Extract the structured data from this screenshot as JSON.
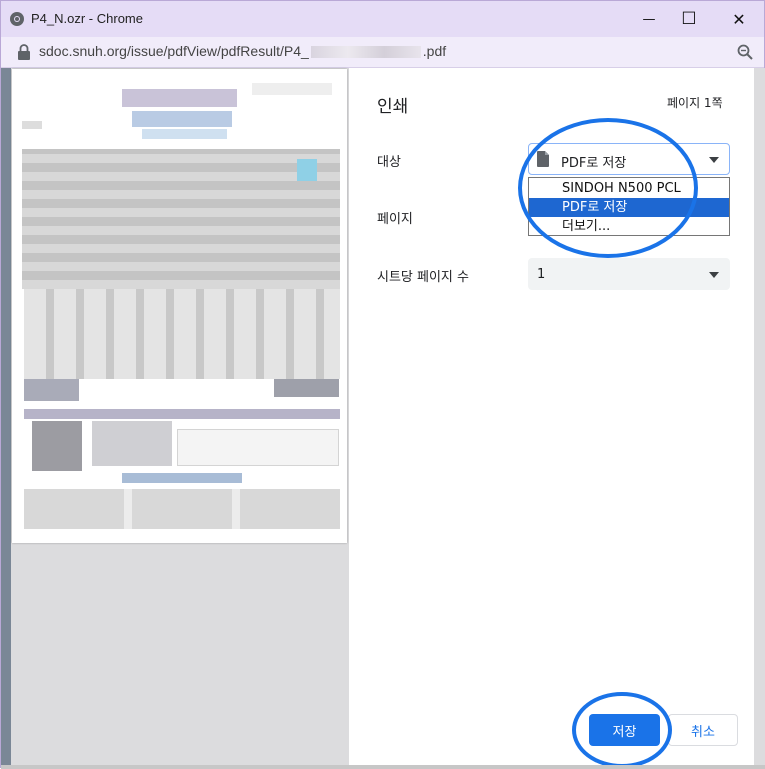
{
  "window": {
    "title": "P4_N.ozr - Chrome",
    "minimize_glyph": "—",
    "maximize_glyph": "☐",
    "close_glyph": "✕"
  },
  "urlbar": {
    "url_prefix": "sdoc.snuh.org/issue/pdfView/pdfResult/P4_",
    "url_suffix": ".pdf"
  },
  "print": {
    "title": "인쇄",
    "page_count": "페이지 1쪽",
    "destination_label": "대상",
    "destination_value": "PDF로 저장",
    "destination_options": [
      "SINDOH N500 PCL",
      "PDF로 저장",
      "더보기..."
    ],
    "pages_label": "페이지",
    "pages_per_sheet_label": "시트당 페이지 수",
    "pages_per_sheet_value": "1",
    "save_button": "저장",
    "cancel_button": "취소"
  },
  "colors": {
    "accent": "#1a73e8",
    "selected_option": "#1e67d1",
    "titlebar": "#e5dcf6"
  }
}
